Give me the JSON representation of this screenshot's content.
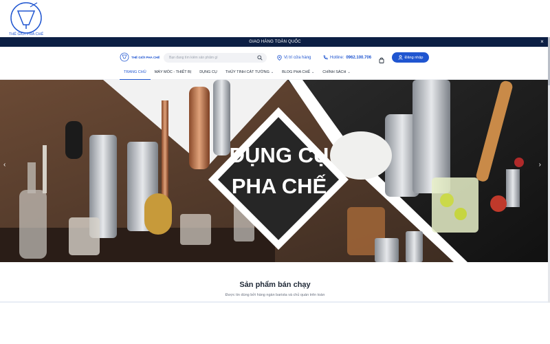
{
  "brand": {
    "outer_logo_text": "THẾ GIỚI PHA CHẾ",
    "inner_logo_text": "THẾ GIỚI PHA CHẾ",
    "primary_color": "#1f55d0",
    "dark_color": "#0c1f44"
  },
  "announcement": {
    "text": "GIAO HÀNG TOÀN QUỐC",
    "close": "×"
  },
  "header": {
    "search_placeholder": "Bạn đang tìm kiếm sản phẩm gì",
    "store_label": "Vị trí cửa hàng",
    "hotline_label": "Hotline:",
    "hotline_number": "0962.100.706",
    "login_label": "Đăng nhập"
  },
  "nav": {
    "items": [
      {
        "label": "TRANG CHỦ",
        "active": true
      },
      {
        "label": "MÁY MÓC - THIẾT BỊ"
      },
      {
        "label": "DỤNG CỤ"
      },
      {
        "label": "THỦY TINH CÁT TƯỜNG",
        "chevron": "⌄"
      },
      {
        "label": "BLOG PHA CHẾ",
        "chevron": "⌄"
      },
      {
        "label": "CHÍNH SÁCH",
        "chevron": "⌄"
      }
    ]
  },
  "hero": {
    "line1": "DỤNG CỤ",
    "line2": "PHA CHẾ",
    "prev": "‹",
    "next": "›"
  },
  "bestsellers": {
    "title": "Sản phẩm bán chạy",
    "subtitle": "Được tin dùng bởi hàng ngàn barista và chủ quán trên toàn"
  },
  "icons": [
    "logo-icon",
    "close-icon",
    "search-icon",
    "location-pin-icon",
    "phone-icon",
    "bag-icon",
    "user-icon",
    "chevron-down-icon",
    "chevron-left-icon",
    "chevron-right-icon"
  ]
}
